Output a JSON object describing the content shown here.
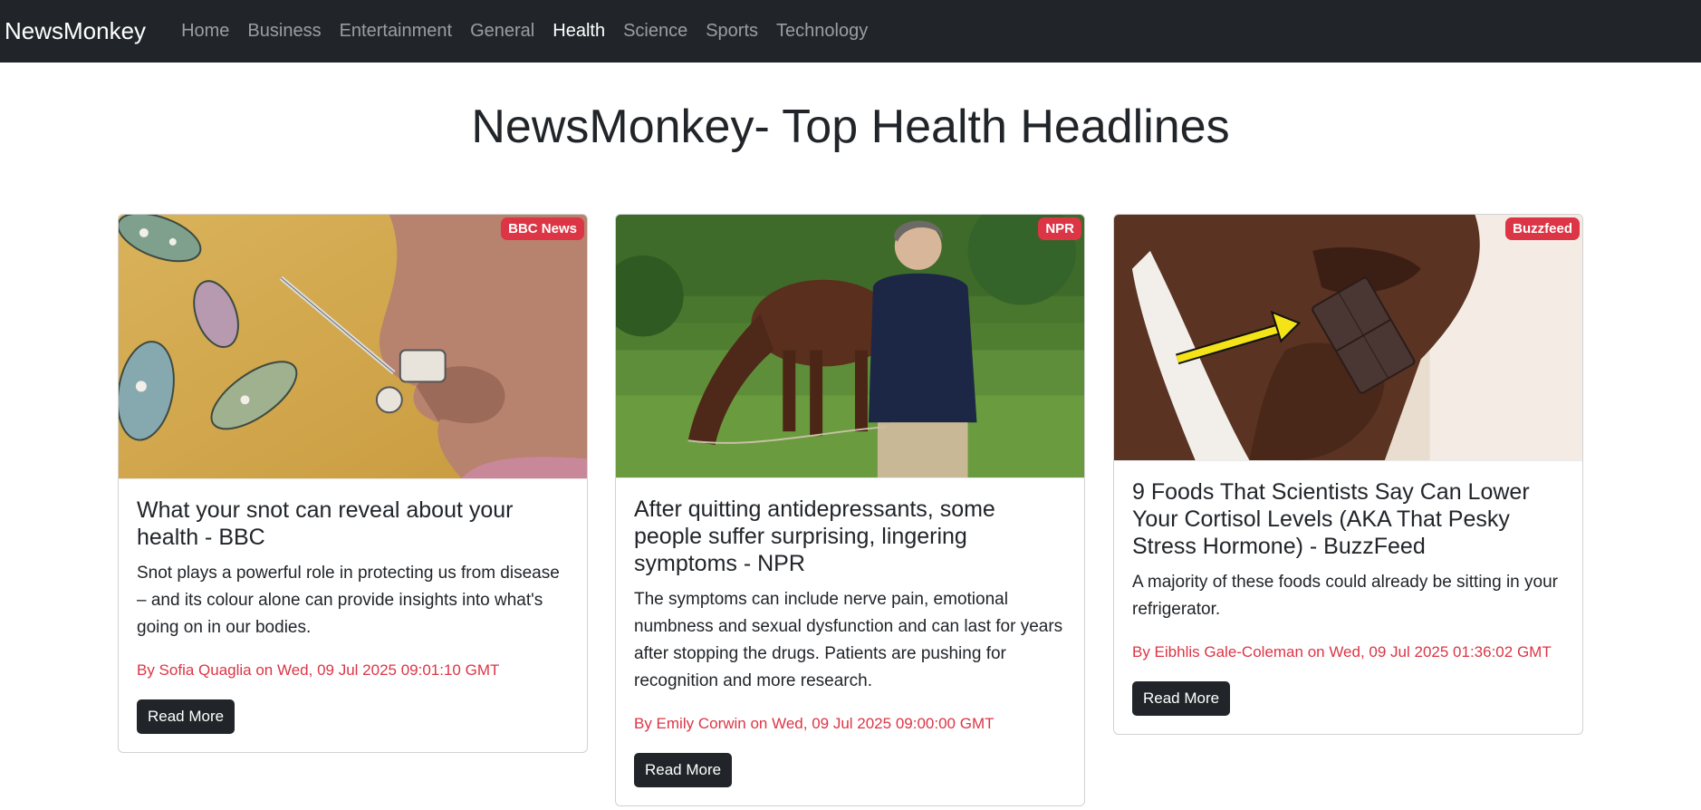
{
  "nav": {
    "brand": "NewsMonkey",
    "items": [
      {
        "label": "Home",
        "active": false
      },
      {
        "label": "Business",
        "active": false
      },
      {
        "label": "Entertainment",
        "active": false
      },
      {
        "label": "General",
        "active": false
      },
      {
        "label": "Health",
        "active": true
      },
      {
        "label": "Science",
        "active": false
      },
      {
        "label": "Sports",
        "active": false
      },
      {
        "label": "Technology",
        "active": false
      }
    ]
  },
  "page": {
    "title": "NewsMonkey- Top Health Headlines"
  },
  "articles": [
    {
      "source": "BBC News",
      "title": "What your snot can reveal about your health - BBC",
      "description": "Snot plays a powerful role in protecting us from disease – and its colour alone can provide insights into what's going on in our bodies.",
      "byline": "By Sofia Quaglia on Wed, 09 Jul 2025 09:01:10 GMT",
      "button": "Read More",
      "image": "nose-illustration-image"
    },
    {
      "source": "NPR",
      "title": "After quitting antidepressants, some people suffer surprising, lingering symptoms - NPR",
      "description": "The symptoms can include nerve pain, emotional numbness and sexual dysfunction and can last for years after stopping the drugs. Patients are pushing for recognition and more research.",
      "byline": "By Emily Corwin on Wed, 09 Jul 2025 09:00:00 GMT",
      "button": "Read More",
      "image": "woman-with-horse-photo"
    },
    {
      "source": "Buzzfeed",
      "title": "9 Foods That Scientists Say Can Lower Your Cortisol Levels (AKA That Pesky Stress Hormone) - BuzzFeed",
      "description": "A majority of these foods could already be sitting in your refrigerator.",
      "byline": "By Eibhlis Gale-Coleman on Wed, 09 Jul 2025 01:36:02 GMT",
      "button": "Read More",
      "image": "woman-eating-chocolate-photo"
    }
  ],
  "colors": {
    "navbar": "#212529",
    "badge": "#dc3545",
    "byline": "#dc3545",
    "button": "#212529"
  }
}
